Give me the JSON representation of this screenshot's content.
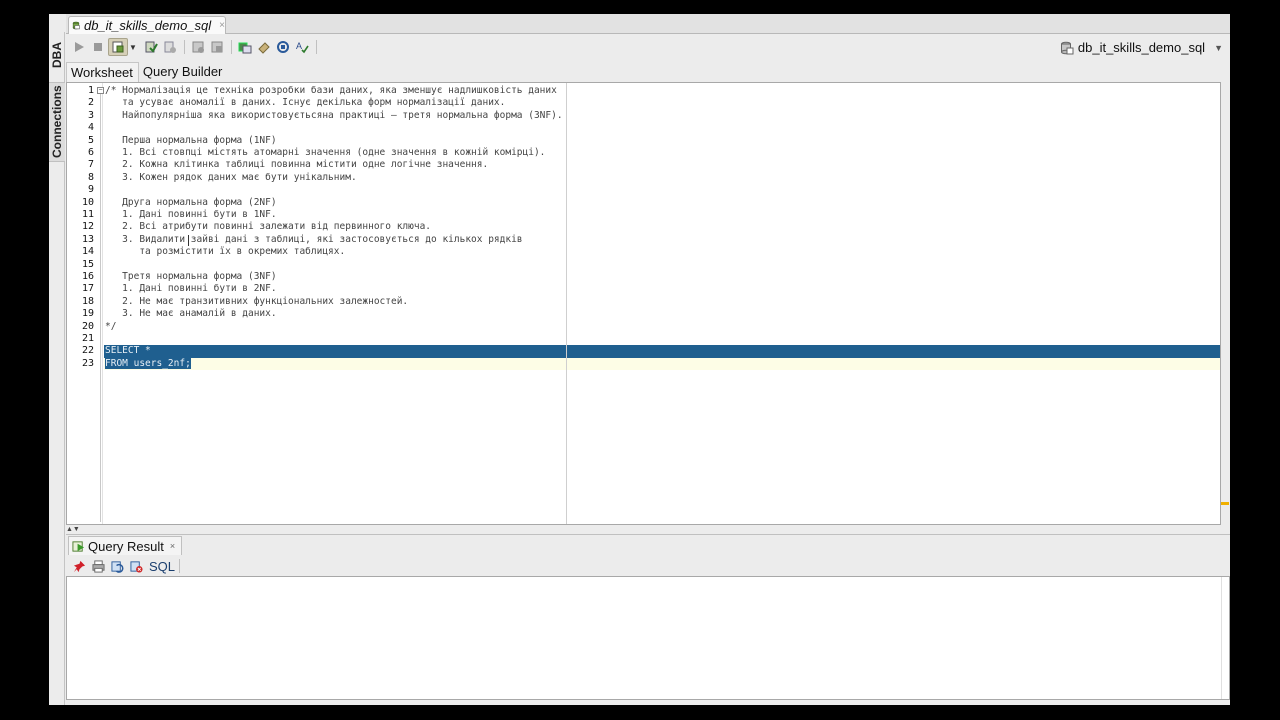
{
  "document_tab": {
    "title": "db_it_skills_demo_sql",
    "close": "×"
  },
  "side_tabs": {
    "dba": "DBA",
    "connections": "Connections"
  },
  "toolbar": {
    "buttons": [
      "run-statement",
      "stop",
      "run-script",
      "commit",
      "rollback",
      "autotrace",
      "explain-plan",
      "sql-tuning",
      "clear",
      "format",
      "sql-history"
    ],
    "connection": "db_it_skills_demo_sql"
  },
  "subtabs": {
    "worksheet": "Worksheet",
    "query_builder": "Query Builder"
  },
  "editor": {
    "lines": [
      {
        "n": "1",
        "text": "/* Нормалізація це техніка розробки бази даних, яка зменшує надлишковість даних"
      },
      {
        "n": "2",
        "text": "   та усуває аномалії в даних. Існує декілька форм нормалізації даних."
      },
      {
        "n": "3",
        "text": "   Найпопулярніша яка використовуєтьсяна практиці – третя нормальна форма (3NF)."
      },
      {
        "n": "4",
        "text": ""
      },
      {
        "n": "5",
        "text": "   Перша нормальна форма (1NF)"
      },
      {
        "n": "6",
        "text": "   1. Всі стовпці містять атомарні значення (одне значення в кожній комірці)."
      },
      {
        "n": "7",
        "text": "   2. Кожна клітинка таблиці повинна містити одне логічне значення."
      },
      {
        "n": "8",
        "text": "   3. Кожен рядок даних має бути унікальним."
      },
      {
        "n": "9",
        "text": ""
      },
      {
        "n": "10",
        "text": "   Друга нормальна форма (2NF)"
      },
      {
        "n": "11",
        "text": "   1. Дані повинні бути в 1NF."
      },
      {
        "n": "12",
        "text": "   2. Всі атрибути повинні залежати від первинного ключа."
      },
      {
        "n": "13",
        "text": "   3. Видалити зайві дані з таблиці, які застосовується до кількох рядків"
      },
      {
        "n": "14",
        "text": "      та розмістити їх в окремих таблицях."
      },
      {
        "n": "15",
        "text": ""
      },
      {
        "n": "16",
        "text": "   Третя нормальна форма (3NF)"
      },
      {
        "n": "17",
        "text": "   1. Дані повинні бути в 2NF."
      },
      {
        "n": "18",
        "text": "   2. Не має транзитивних функціональних залежностей."
      },
      {
        "n": "19",
        "text": "   3. Не має анамалій в даних."
      },
      {
        "n": "20",
        "text": "*/"
      },
      {
        "n": "21",
        "text": ""
      },
      {
        "n": "22",
        "text": "SELECT *"
      },
      {
        "n": "23",
        "text": "FROM users_2nf;"
      }
    ]
  },
  "result_panel": {
    "tab_label": "Query Result",
    "close": "×",
    "sql_label": "SQL"
  }
}
